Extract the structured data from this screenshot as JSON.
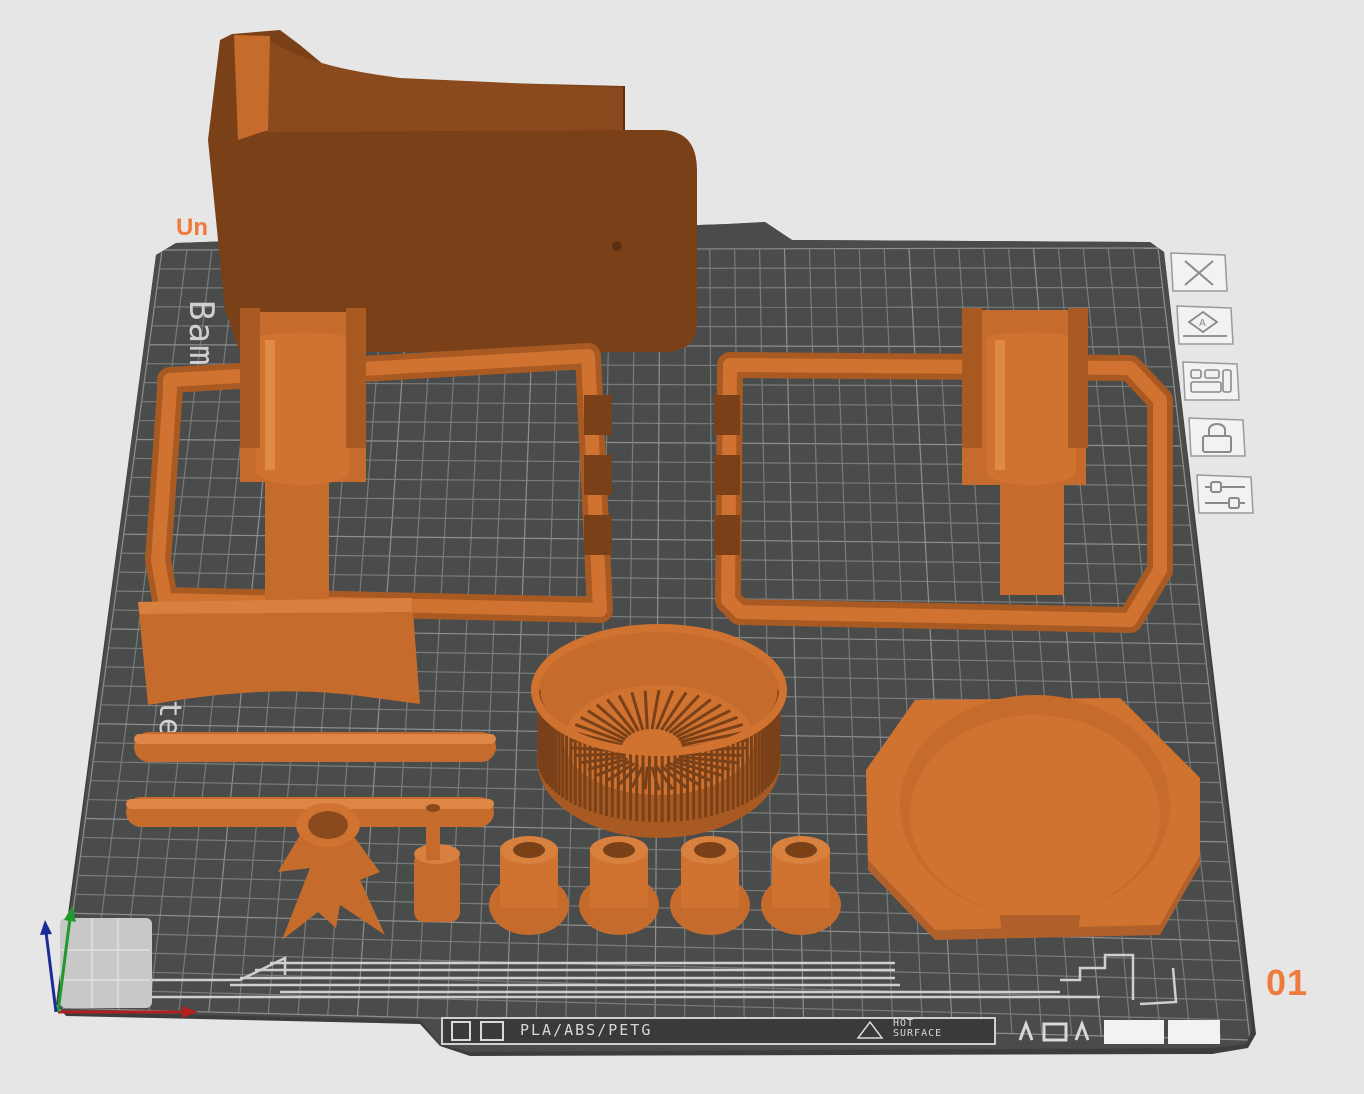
{
  "plate": {
    "name_label": "Un",
    "number_label": "01",
    "filament_types": "PLA/ABS/PETG",
    "warning_line1": "HOT",
    "warning_line2": "SURFACE"
  },
  "toolbar": {
    "items": [
      {
        "name": "close-plate",
        "icon": "close-icon"
      },
      {
        "name": "auto-arrange",
        "icon": "arrange-icon"
      },
      {
        "name": "auto-orient",
        "icon": "orient-icon"
      },
      {
        "name": "lock-plate",
        "icon": "lock-icon"
      },
      {
        "name": "plate-settings",
        "icon": "settings-icon"
      }
    ]
  },
  "colors": {
    "background": "#e6e6e6",
    "plate": "#4a4b4b",
    "plate_border": "#3a3a3a",
    "grid": "#7b7b7b",
    "model_face": "#d07230",
    "model_dark": "#7a4119",
    "accent": "#ee7a3c"
  }
}
